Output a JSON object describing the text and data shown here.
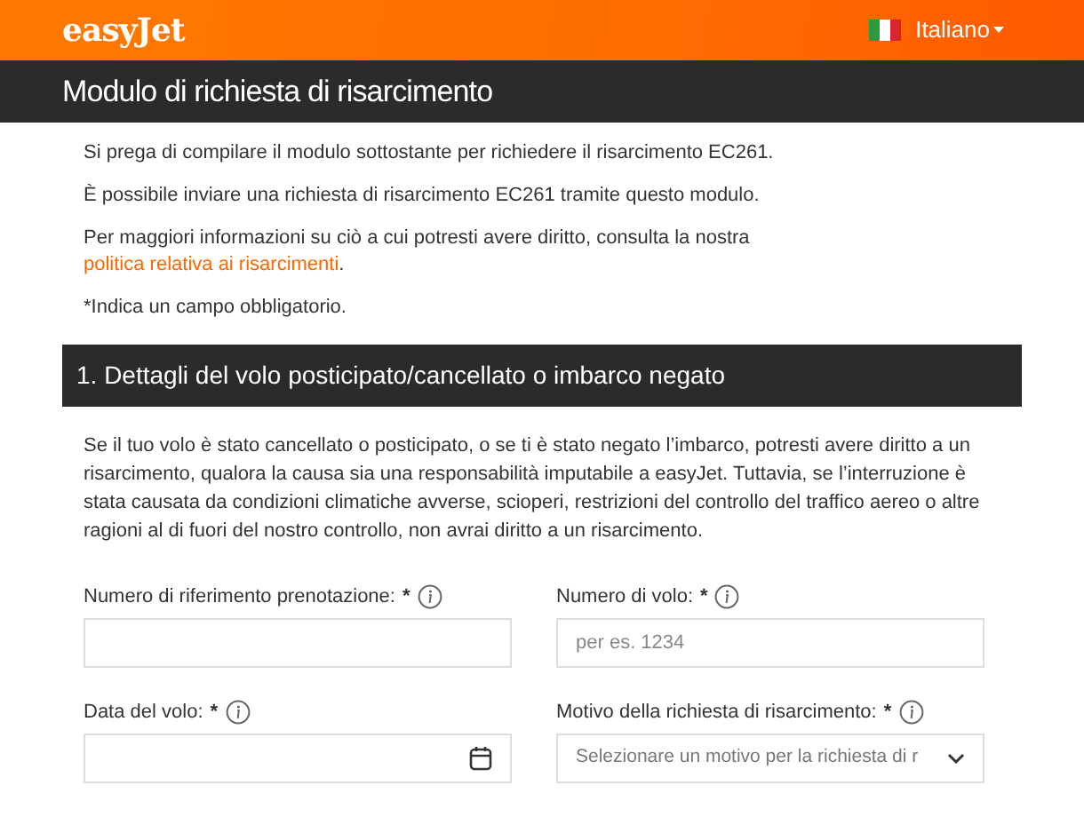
{
  "header": {
    "logo": "easyJet",
    "language": "Italiano"
  },
  "page_title": "Modulo di richiesta di risarcimento",
  "intro": [
    "Si prega di compilare il modulo sottostante per richiedere il risarcimento EC261.",
    "È possibile inviare una richiesta di risarcimento EC261 tramite questo modulo."
  ],
  "info": {
    "text": "Per maggiori informazioni su ciò a cui potresti avere diritto, consulta la nostra",
    "link": "politica relativa ai risarcimenti",
    "end": "."
  },
  "required_note": "*Indica un campo obbligatorio.",
  "section": {
    "title": "1. Dettagli del volo posticipato/cancellato o imbarco negato",
    "description": "Se il tuo volo è stato cancellato o posticipato, o se ti è stato negato l’imbarco, potresti avere diritto a un risarcimento, qualora la causa sia una responsabilità imputabile a easyJet. Tuttavia, se l’interruzione è stata causata da condizioni climatiche avverse, scioperi, restrizioni del controllo del traffico aereo o altre ragioni al di fuori del nostro controllo, non avrai diritto a un risarcimento."
  },
  "fields": [
    {
      "kind": "text",
      "label": "Numero di riferimento prenotazione:",
      "required": "*"
    },
    {
      "kind": "text",
      "label": "Numero di volo:",
      "required": "*",
      "placeholder": "per es. 1234"
    },
    {
      "kind": "date",
      "label": "Data del volo:",
      "required": "*"
    },
    {
      "kind": "select",
      "label": "Motivo della richiesta di risarcimento:",
      "required": "*",
      "placeholder": "Selezionare un motivo per la richiesta di r"
    }
  ]
}
